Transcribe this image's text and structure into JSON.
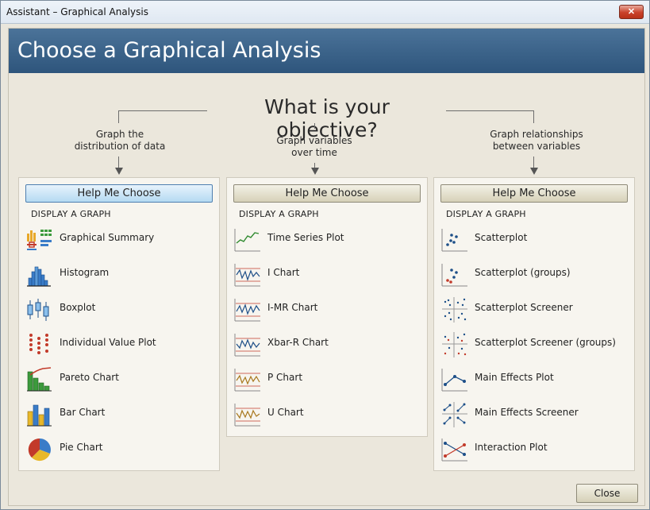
{
  "window": {
    "title": "Assistant – Graphical Analysis",
    "close_glyph": "✕"
  },
  "header": {
    "title": "Choose a Graphical Analysis"
  },
  "objective": "What is your objective?",
  "columns": [
    {
      "question": "Graph the\ndistribution of data",
      "help_label": "Help Me Choose",
      "section": "DISPLAY A GRAPH",
      "items": [
        {
          "label": "Graphical Summary",
          "icon": "graphical-summary-icon"
        },
        {
          "label": "Histogram",
          "icon": "histogram-icon"
        },
        {
          "label": "Boxplot",
          "icon": "boxplot-icon"
        },
        {
          "label": "Individual Value Plot",
          "icon": "individual-value-plot-icon"
        },
        {
          "label": "Pareto Chart",
          "icon": "pareto-chart-icon"
        },
        {
          "label": "Bar Chart",
          "icon": "bar-chart-icon"
        },
        {
          "label": "Pie Chart",
          "icon": "pie-chart-icon"
        }
      ]
    },
    {
      "question": "Graph variables\nover time",
      "help_label": "Help Me Choose",
      "section": "DISPLAY A GRAPH",
      "items": [
        {
          "label": "Time Series Plot",
          "icon": "time-series-icon"
        },
        {
          "label": "I Chart",
          "icon": "control-chart-icon"
        },
        {
          "label": "I-MR Chart",
          "icon": "control-chart-icon"
        },
        {
          "label": "Xbar-R Chart",
          "icon": "control-chart-icon"
        },
        {
          "label": "P Chart",
          "icon": "attribute-chart-icon"
        },
        {
          "label": "U Chart",
          "icon": "attribute-chart-icon"
        }
      ]
    },
    {
      "question": "Graph relationships\nbetween variables",
      "help_label": "Help Me Choose",
      "section": "DISPLAY A GRAPH",
      "items": [
        {
          "label": "Scatterplot",
          "icon": "scatterplot-icon"
        },
        {
          "label": "Scatterplot (groups)",
          "icon": "scatterplot-groups-icon"
        },
        {
          "label": "Scatterplot Screener",
          "icon": "scatterplot-screener-icon"
        },
        {
          "label": "Scatterplot Screener (groups)",
          "icon": "scatterplot-screener-groups-icon"
        },
        {
          "label": "Main Effects Plot",
          "icon": "main-effects-icon"
        },
        {
          "label": "Main Effects Screener",
          "icon": "main-effects-screener-icon"
        },
        {
          "label": "Interaction Plot",
          "icon": "interaction-plot-icon"
        }
      ]
    }
  ],
  "footer": {
    "close_label": "Close"
  }
}
